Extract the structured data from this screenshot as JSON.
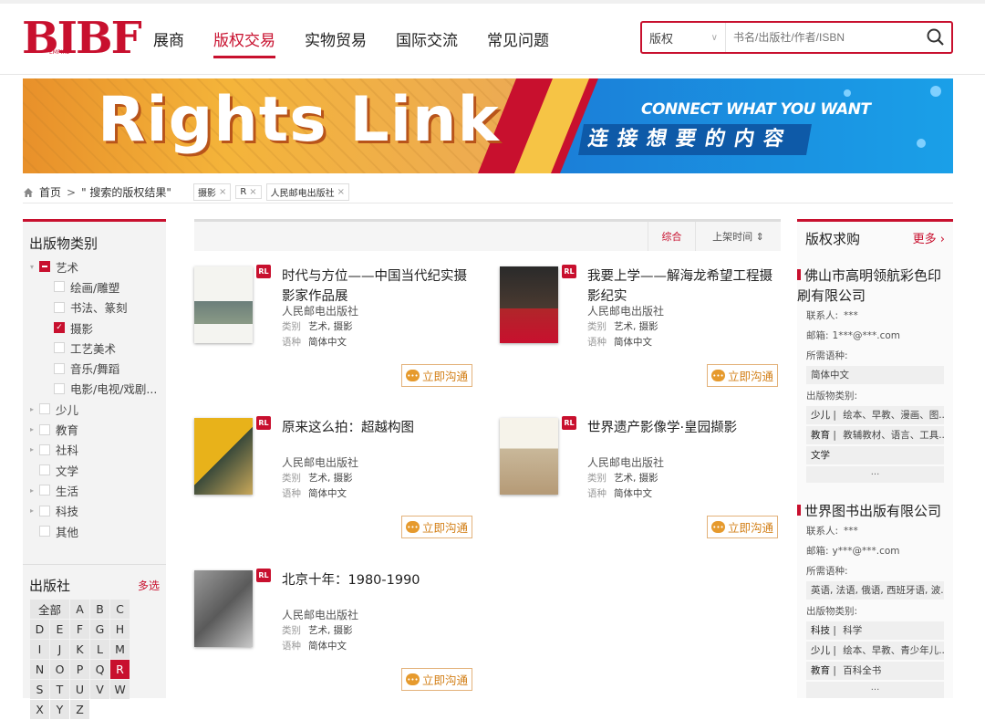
{
  "logo": {
    "text": "BIBF",
    "sub": "EMPIRE"
  },
  "nav": {
    "items": [
      "展商",
      "版权交易",
      "实物贸易",
      "国际交流",
      "常见问题"
    ],
    "active": "版权交易"
  },
  "search": {
    "type": "版权",
    "placeholder": "书名/出版社/作者/ISBN"
  },
  "banner": {
    "title": "Rights Link",
    "en": "CONNECT WHAT YOU WANT",
    "cn": "连接想要的内容"
  },
  "breadcrumb": {
    "home": "首页",
    "current": "\" 搜索的版权结果\"",
    "tags": [
      "摄影",
      "R",
      "人民邮电出版社"
    ]
  },
  "categories": {
    "title": "出版物类别",
    "items": [
      {
        "label": "艺术",
        "state": "partial",
        "expanded": true
      },
      {
        "label": "绘画/雕塑",
        "state": "off",
        "sub": true
      },
      {
        "label": "书法、篆刻",
        "state": "off",
        "sub": true
      },
      {
        "label": "摄影",
        "state": "on",
        "sub": true
      },
      {
        "label": "工艺美术",
        "state": "off",
        "sub": true
      },
      {
        "label": "音乐/舞蹈",
        "state": "off",
        "sub": true
      },
      {
        "label": "电影/电视/戏剧...",
        "state": "off",
        "sub": true
      },
      {
        "label": "少儿",
        "state": "off",
        "arrow": true
      },
      {
        "label": "教育",
        "state": "off",
        "arrow": true
      },
      {
        "label": "社科",
        "state": "off",
        "arrow": true
      },
      {
        "label": "文学",
        "state": "off"
      },
      {
        "label": "生活",
        "state": "off",
        "arrow": true
      },
      {
        "label": "科技",
        "state": "off",
        "arrow": true
      },
      {
        "label": "其他",
        "state": "off"
      }
    ]
  },
  "publisher": {
    "title": "出版社",
    "multi": "多选",
    "letters": [
      "全部",
      "A",
      "B",
      "C",
      "D",
      "E",
      "F",
      "G",
      "H",
      "I",
      "J",
      "K",
      "L",
      "M",
      "N",
      "O",
      "P",
      "Q",
      "R",
      "S",
      "T",
      "U",
      "V",
      "W",
      "X",
      "Y",
      "Z"
    ],
    "selected": "R"
  },
  "sort": {
    "options": [
      "综合",
      "上架时间 ⇕"
    ],
    "active": "综合"
  },
  "books": [
    {
      "title": "时代与方位——中国当代纪实摄影家作品展",
      "publisher": "人民邮电出版社",
      "category": "艺术, 摄影",
      "language": "简体中文",
      "badge": "RL",
      "action": "立即沟通"
    },
    {
      "title": "我要上学——解海龙希望工程摄影纪实",
      "publisher": "人民邮电出版社",
      "category": "艺术, 摄影",
      "language": "简体中文",
      "badge": "RL",
      "action": "立即沟通"
    },
    {
      "title": "原来这么拍：超越构图",
      "publisher": "人民邮电出版社",
      "category": "艺术, 摄影",
      "language": "简体中文",
      "badge": "RL",
      "action": "立即沟通"
    },
    {
      "title": "世界遗产影像学·皇园撷影",
      "publisher": "人民邮电出版社",
      "category": "艺术, 摄影",
      "language": "简体中文",
      "badge": "RL",
      "action": "立即沟通"
    },
    {
      "title": "北京十年：1980-1990",
      "publisher": "人民邮电出版社",
      "category": "艺术, 摄影",
      "language": "简体中文",
      "badge": "RL",
      "action": "立即沟通"
    }
  ],
  "labels": {
    "category": "类别",
    "language": "语种"
  },
  "requests": {
    "title": "版权求购",
    "more": "更多",
    "contact_label": "联系人:",
    "email_label": "邮箱:",
    "lang_label": "所需语种:",
    "cat_label": "出版物类别:",
    "items": [
      {
        "name": "佛山市高明领航彩色印刷有限公司",
        "contact": "***",
        "email": "1***@***.com",
        "languages": [
          "简体中文"
        ],
        "categories": [
          {
            "main": "少儿",
            "sub": "绘本、早教、漫画、图..."
          },
          {
            "main": "教育",
            "sub": "教辅教材、语言、工具..."
          },
          {
            "main": "文学",
            "sub": ""
          }
        ]
      },
      {
        "name": "世界图书出版有限公司",
        "contact": "***",
        "email": "y***@***.com",
        "languages": [
          "英语, 法语, 俄语, 西班牙语, 波..."
        ],
        "categories": [
          {
            "main": "科技",
            "sub": "科学"
          },
          {
            "main": "少儿",
            "sub": "绘本、早教、青少年儿..."
          },
          {
            "main": "教育",
            "sub": "百科全书"
          }
        ]
      }
    ]
  },
  "colors": {
    "brand": "#c8102e",
    "accent": "#d38019"
  }
}
